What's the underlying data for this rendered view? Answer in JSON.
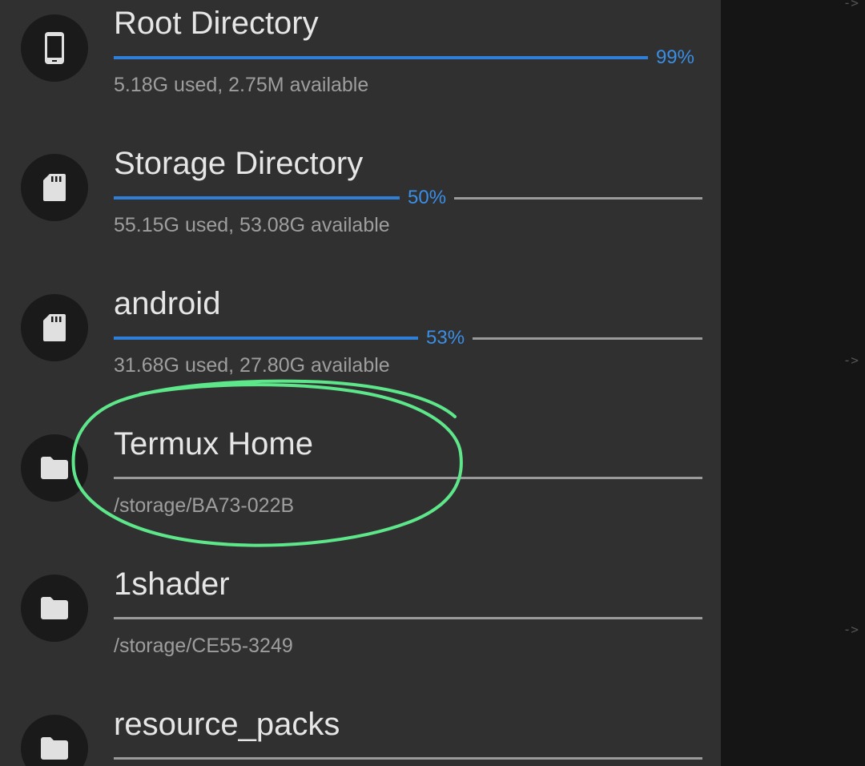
{
  "drawer": {
    "items": [
      {
        "title": "Root Directory",
        "usage_text": "5.18G used, 2.75M available",
        "percent_label": "99%",
        "percent": 99,
        "icon": "phone-icon"
      },
      {
        "title": "Storage Directory",
        "usage_text": "55.15G used, 53.08G available",
        "percent_label": "50%",
        "percent": 50,
        "icon": "sd-card-icon"
      },
      {
        "title": "android",
        "usage_text": "31.68G used, 27.80G available",
        "percent_label": "53%",
        "percent": 53,
        "icon": "sd-card-icon"
      },
      {
        "title": "Termux Home",
        "path": "/storage/BA73-022B",
        "icon": "folder-icon"
      },
      {
        "title": "1shader",
        "path": "/storage/CE55-3249",
        "icon": "folder-icon"
      },
      {
        "title": "resource_packs",
        "icon": "folder-icon"
      }
    ]
  },
  "background": {
    "arrow_hints": [
      "->",
      "->",
      "->"
    ]
  },
  "colors": {
    "drawer_bg": "#303030",
    "accent": "#2f7ed8",
    "annotation": "#5ee68a"
  }
}
